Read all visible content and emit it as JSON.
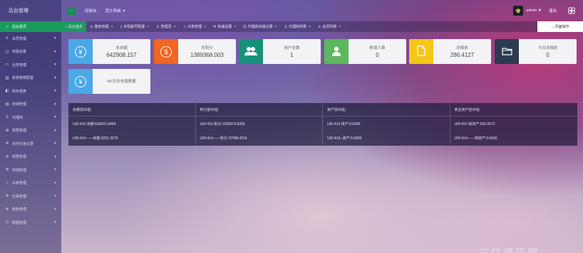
{
  "header": {
    "brand": "后台管理",
    "menu_icon": "menu-dots-icon",
    "nav": [
      {
        "label": "控制台"
      },
      {
        "label": "其它系统",
        "caret": "▼"
      }
    ],
    "user": "admin",
    "user_caret": "▼",
    "logout": "退出"
  },
  "sidebar": {
    "items": [
      {
        "label": "后台首页",
        "icon": "home-icon",
        "glyph": "⌂",
        "active": true
      },
      {
        "label": "会员管理",
        "icon": "user-icon",
        "glyph": "♙"
      },
      {
        "label": "奖励设置",
        "icon": "gift-icon",
        "glyph": "◫"
      },
      {
        "label": "业务管理",
        "icon": "briefcase-icon",
        "glyph": "▭"
      },
      {
        "label": "系统参数配置",
        "icon": "chart-icon",
        "glyph": "▥"
      },
      {
        "label": "财务报表",
        "icon": "report-icon",
        "glyph": "◧"
      },
      {
        "label": "商城管理",
        "icon": "shop-icon",
        "glyph": "▤"
      },
      {
        "label": "代理商",
        "icon": "agent-icon",
        "glyph": "♙"
      },
      {
        "label": "权限管理",
        "icon": "grid-icon",
        "glyph": "⊞"
      },
      {
        "label": "兵币交易记录",
        "icon": "gear-icon",
        "glyph": "✲"
      },
      {
        "label": "权限管理",
        "icon": "gear-icon",
        "glyph": "✲"
      },
      {
        "label": "商城管理",
        "icon": "gear-icon",
        "glyph": "✲"
      },
      {
        "label": "众筹管理",
        "icon": "crowd-icon",
        "glyph": "♧"
      },
      {
        "label": "交易管理",
        "icon": "gear-icon",
        "glyph": "✲"
      },
      {
        "label": "转账管理",
        "icon": "gear-icon",
        "glyph": "✲"
      },
      {
        "label": "数据管理",
        "icon": "circle-gear-icon",
        "glyph": "⊙"
      }
    ]
  },
  "tabs": [
    {
      "label": "后台首页",
      "icon": "home-icon",
      "glyph": "⌂",
      "active": true
    },
    {
      "label": "角色管理",
      "icon": "users-icon",
      "glyph": "♙",
      "close": "×"
    },
    {
      "label": "手机版号配置",
      "icon": "phone-icon",
      "glyph": "▯",
      "close": "×"
    },
    {
      "label": "管理员",
      "icon": "user-icon",
      "glyph": "♙",
      "close": "×"
    },
    {
      "label": "众筹管理",
      "icon": "crowd-icon",
      "glyph": "♧",
      "close": "×"
    },
    {
      "label": "商城设置",
      "icon": "gear-icon",
      "glyph": "✲",
      "close": "×"
    },
    {
      "label": "代理商充值记录",
      "icon": "list-icon",
      "glyph": "☰",
      "close": "×"
    },
    {
      "label": "代理商列表",
      "icon": "agent-icon",
      "glyph": "♙",
      "close": "×"
    },
    {
      "label": "会员列表",
      "icon": "member-icon",
      "glyph": "♙",
      "close": "×"
    }
  ],
  "page_ops": {
    "label": "页面操作",
    "caret": "⌵"
  },
  "cards": [
    {
      "label": "总余额",
      "value": "642908.157",
      "icon": "yen-icon",
      "glyph": "¥",
      "color": "#4aa8e6"
    },
    {
      "label": "总积分",
      "value": "1389368.003",
      "icon": "dollar-icon",
      "glyph": "$",
      "color": "#f26522"
    },
    {
      "label": "用户总数",
      "value": "1",
      "icon": "users-icon",
      "glyph": "👥",
      "color": "#17927a"
    },
    {
      "label": "新增人数",
      "value": "0",
      "icon": "user-icon",
      "glyph": "👤",
      "color": "#5cb85c"
    },
    {
      "label": "总释放",
      "value": "286.4127",
      "icon": "file-icon",
      "glyph": "▯",
      "color": "#f5c518"
    },
    {
      "label": "今日总释放",
      "value": "0",
      "icon": "folder-icon",
      "glyph": "▭",
      "color": "#2b3a4f"
    },
    {
      "label": "KK币总充值数量",
      "value": "",
      "icon": "yen-icon",
      "glyph": "¥",
      "color": "#4aa8e6"
    }
  ],
  "panel": {
    "headers": [
      "余额前30名:",
      "积分前30名:",
      "资产前30名:",
      "商业资产前30名:"
    ],
    "rows": [
      [
        "UID:410    余额:639616.9494",
        "UID:410    积分:1305579.5006",
        "UID:414    资产:0.0000",
        "UID:410    商资产:200.0072"
      ],
      [
        "UID:414——余额:3291.2076",
        "UID:414——积分:70788.4224",
        "UID:414--资产:0.0000",
        "UID:414——商资产:0.0000"
      ]
    ]
  },
  "watermark": "三亿源码网"
}
